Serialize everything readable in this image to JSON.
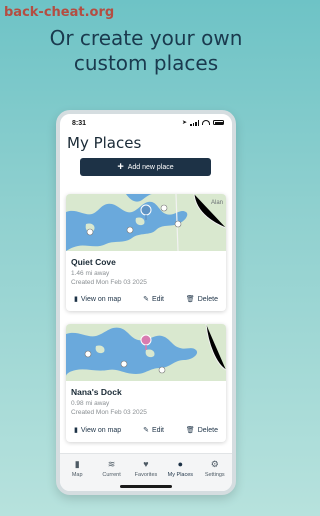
{
  "watermark": "back-cheat.org",
  "headline": [
    "Or create your own",
    "custom places"
  ],
  "status_bar": {
    "time": "8:31"
  },
  "page": {
    "title": "My Places"
  },
  "add_button": {
    "label": "Add new place"
  },
  "places": [
    {
      "name": "Quiet Cove",
      "distance": "1.46 mi away",
      "created": "Created Mon Feb 03 2025",
      "map_label": "Alan"
    },
    {
      "name": "Nana's Dock",
      "distance": "0.98 mi away",
      "created": "Created Mon Feb 03 2025",
      "map_label": ""
    }
  ],
  "actions": {
    "view": "View on map",
    "edit": "Edit",
    "delete": "Delete"
  },
  "tabs": [
    {
      "label": "Map",
      "icon": "map-icon"
    },
    {
      "label": "Current",
      "icon": "waves-icon"
    },
    {
      "label": "Favorites",
      "icon": "heart-icon"
    },
    {
      "label": "My Places",
      "icon": "location-pin-icon"
    },
    {
      "label": "Settings",
      "icon": "gear-icon"
    }
  ],
  "active_tab": "My Places",
  "colors": {
    "primary": "#1d3246",
    "background": "#7ec9c9",
    "map_water": "#6aa9dc",
    "map_land": "#d9e8cf",
    "pin_active": "#d87bb0",
    "pin_default": "#5f93c4"
  }
}
